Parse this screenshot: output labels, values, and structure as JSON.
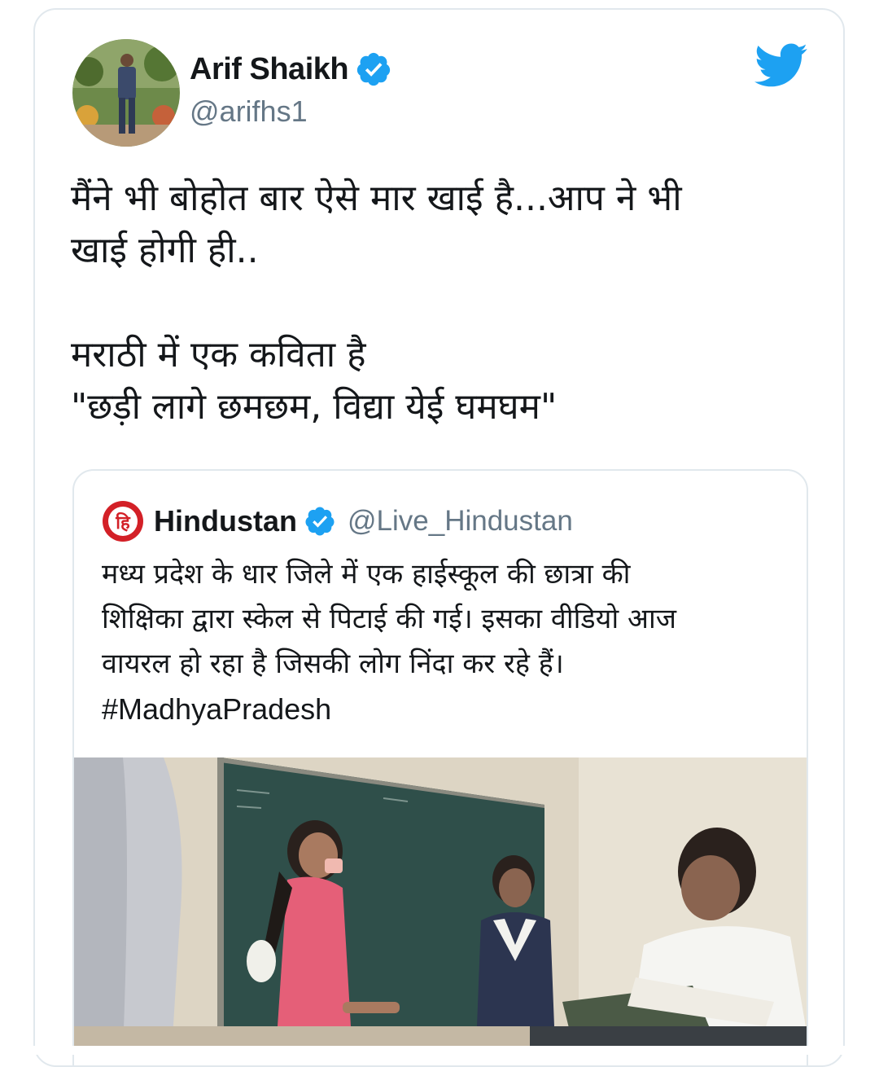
{
  "tweet": {
    "author": {
      "display_name": "Arif Shaikh",
      "handle": "@arifhs1",
      "verified": true
    },
    "text_lines": [
      "मैंने भी बोहोत बार ऐसे मार खाई है...आप ने भी",
      "खाई होगी ही..",
      "",
      "मराठी में एक कविता है",
      "\"छड़ी लागे छमछम, विद्या येई घमघम\""
    ],
    "brand_icon": "twitter-bird-icon",
    "brand_color": "#1da1f2"
  },
  "quoted_tweet": {
    "author": {
      "display_name": "Hindustan",
      "handle": "@Live_Hindustan",
      "logo_text": "हि",
      "logo_color": "#d32027",
      "verified": true
    },
    "text_lines": [
      "मध्य प्रदेश के धार जिले में एक हाईस्कूल की छात्रा की",
      "शिक्षिका द्वारा स्केल से पिटाई की गई। इसका वीडियो आज",
      "वायरल हो रहा है जिसकी लोग निंदा कर रहे हैं।"
    ],
    "hashtag": "#MadhyaPradesh",
    "media": "classroom-photo"
  },
  "colors": {
    "verified_badge": "#1da1f2",
    "handle_gray": "#657786",
    "border": "#e1e8ed"
  }
}
